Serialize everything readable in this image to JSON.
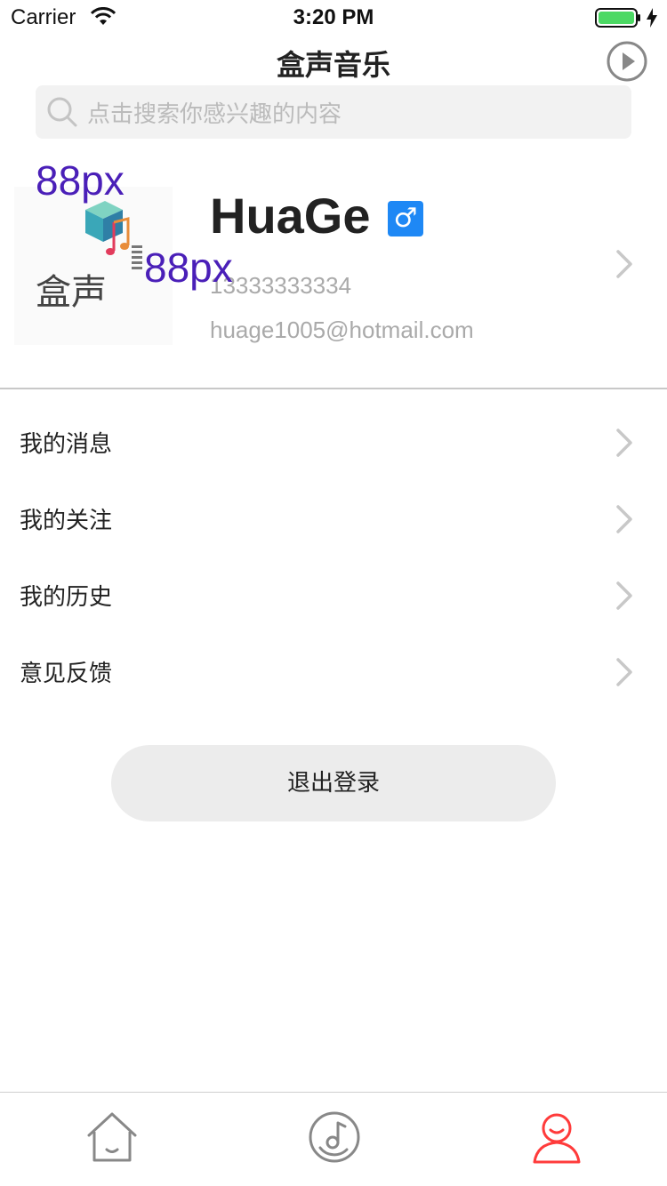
{
  "status_bar": {
    "carrier": "Carrier",
    "time": "3:20 PM"
  },
  "header": {
    "title": "盒声音乐"
  },
  "search": {
    "placeholder": "点击搜索你感兴趣的内容"
  },
  "profile": {
    "dimension_label_top": "88px",
    "dimension_label_right": "88px",
    "name": "HuaGe",
    "gender_symbol": "♂",
    "phone": "13333333334",
    "email": "huage1005@hotmail.com",
    "avatar_logo_text": "盒声"
  },
  "menu": {
    "items": [
      {
        "label": "我的消息"
      },
      {
        "label": "我的关注"
      },
      {
        "label": "我的历史"
      },
      {
        "label": "意见反馈"
      }
    ]
  },
  "logout": {
    "label": "退出登录"
  },
  "tabbar": {
    "tabs": [
      {
        "icon": "home-icon",
        "active": false
      },
      {
        "icon": "music-disc-icon",
        "active": false
      },
      {
        "icon": "profile-icon",
        "active": true
      }
    ]
  },
  "colors": {
    "accent": "#ff3b3b",
    "gender_badge": "#1e88f5",
    "dimension_label": "#4a1fb8",
    "search_bg": "#f2f2f2",
    "logout_bg": "#ececec"
  }
}
